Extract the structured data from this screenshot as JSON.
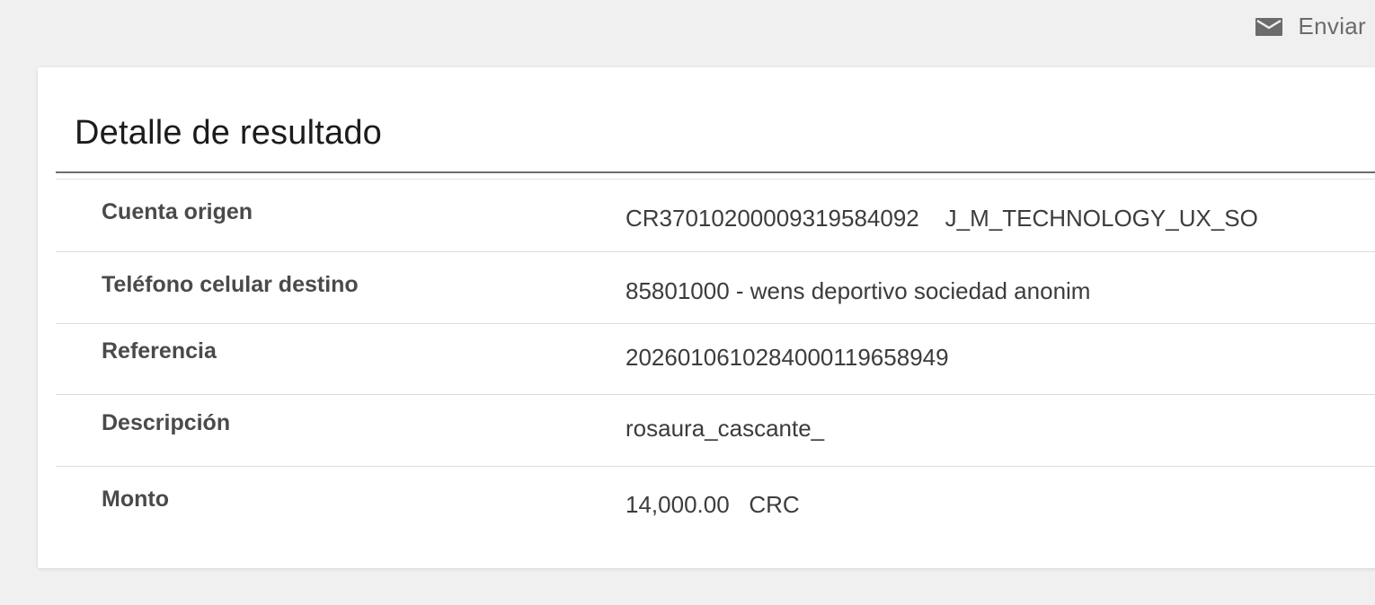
{
  "header": {
    "send_label": "Enviar",
    "send_icon": "envelope-icon"
  },
  "card": {
    "title": "Detalle de resultado"
  },
  "details": [
    {
      "label": "Cuenta origen",
      "value": "CR37010200009319584092    J_M_TECHNOLOGY_UX_SO"
    },
    {
      "label": "Teléfono celular destino",
      "value": "85801000 - wens deportivo sociedad anonim"
    },
    {
      "label": "Referencia",
      "value": "2026010610284000119658949"
    },
    {
      "label": "Descripción",
      "value": "rosaura_cascante_"
    },
    {
      "label": "Monto",
      "value": "14,000.00   CRC"
    }
  ],
  "colors": {
    "background": "#f0f0f0",
    "card": "#ffffff",
    "title_rule": "#6d6d6d",
    "row_divider": "#dcdcdc",
    "icon": "#6b6b6b"
  }
}
